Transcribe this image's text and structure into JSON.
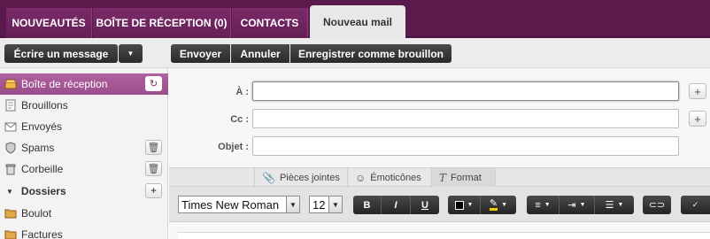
{
  "top_tabs": [
    {
      "label": "NOUVEAUTÉS"
    },
    {
      "label": "BOÎTE DE RÉCEPTION (0)"
    },
    {
      "label": "CONTACTS"
    },
    {
      "label": "Nouveau mail"
    }
  ],
  "toolbar": {
    "write_label": "Écrire un message",
    "send_label": "Envoyer",
    "cancel_label": "Annuler",
    "draft_label": "Enregistrer comme brouillon"
  },
  "sidebar": {
    "items": [
      {
        "label": "Boîte de réception",
        "icon": "inbox-icon"
      },
      {
        "label": "Brouillons",
        "icon": "draft-icon"
      },
      {
        "label": "Envoyés",
        "icon": "sent-icon"
      },
      {
        "label": "Spams",
        "icon": "shield-icon"
      },
      {
        "label": "Corbeille",
        "icon": "trash-icon"
      }
    ],
    "folders_label": "Dossiers",
    "folders": [
      {
        "label": "Boulot",
        "icon": "folder-icon"
      },
      {
        "label": "Factures",
        "icon": "folder-icon"
      }
    ]
  },
  "compose": {
    "to_label": "À :",
    "cc_label": "Cc :",
    "subject_label": "Objet :",
    "to_value": "",
    "cc_value": "",
    "subject_value": ""
  },
  "attach_tabs": [
    {
      "label": "Pièces jointes",
      "icon": "paperclip-icon"
    },
    {
      "label": "Émoticônes",
      "icon": "smiley-icon"
    },
    {
      "label": "Format",
      "icon": "format-icon"
    }
  ],
  "editor": {
    "font_family": "Times New Roman",
    "font_size": "12",
    "bold": "B",
    "italic": "I",
    "underline": "U"
  },
  "colors": {
    "brand_purple": "#5b1a4c",
    "active_purple": "#a3559a",
    "dark_button": "#2e2e2e"
  }
}
